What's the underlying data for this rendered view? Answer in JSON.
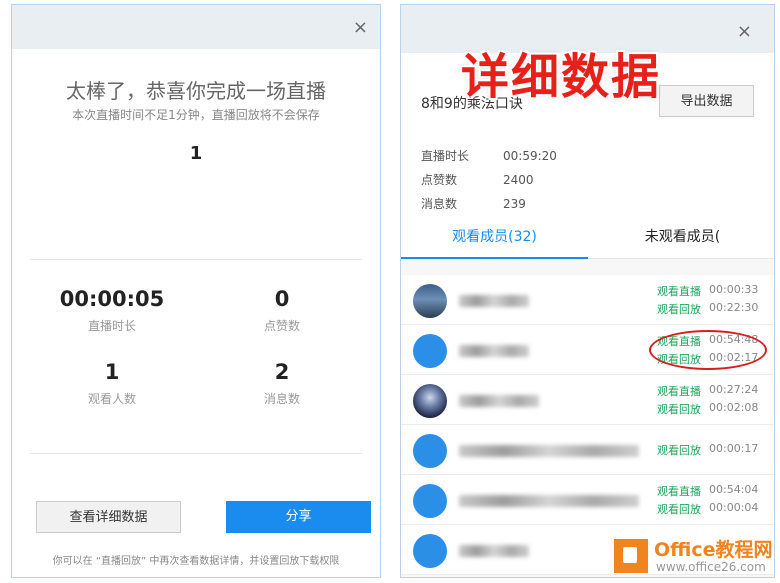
{
  "left_panel": {
    "close": "×",
    "title": "太棒了，恭喜你完成一场直播",
    "subtitle": "本次直播时间不足1分钟，直播回放将不会保存",
    "rank": "1",
    "stats": [
      {
        "value": "00:00:05",
        "label": "直播时长"
      },
      {
        "value": "0",
        "label": "点赞数"
      },
      {
        "value": "1",
        "label": "观看人数"
      },
      {
        "value": "2",
        "label": "消息数"
      }
    ],
    "buttons": {
      "details": "查看详细数据",
      "share": "分享"
    },
    "footer": "你可以在 “直播回放” 中再次查看数据详情，并设置回放下载权限"
  },
  "right_panel": {
    "close": "×",
    "overlay_title": "详细数据",
    "course": "8和9的乘法口诀",
    "export_button": "导出数据",
    "info": [
      {
        "label": "直播时长",
        "value": "00:59:20"
      },
      {
        "label": "点赞数",
        "value": "2400"
      },
      {
        "label": "消息数",
        "value": "239"
      }
    ],
    "tabs": {
      "watched": "观看成员(32)",
      "unwatched": "未观看成员("
    },
    "members": [
      {
        "avatar": "photo",
        "name_width": 70,
        "acts": [
          {
            "label": "观看直播",
            "time": "00:00:33"
          },
          {
            "label": "观看回放",
            "time": "00:22:30"
          }
        ]
      },
      {
        "avatar": "blue",
        "name_width": 70,
        "acts": [
          {
            "label": "观看直播",
            "time": "00:54:48"
          },
          {
            "label": "观看回放",
            "time": "00:02:17"
          }
        ]
      },
      {
        "avatar": "dark",
        "name_width": 80,
        "acts": [
          {
            "label": "观看直播",
            "time": "00:27:24"
          },
          {
            "label": "观看回放",
            "time": "00:02:08"
          }
        ]
      },
      {
        "avatar": "blue",
        "name_width": 180,
        "acts": [
          {
            "label": "观看回放",
            "time": "00:00:17"
          }
        ]
      },
      {
        "avatar": "blue",
        "name_width": 180,
        "acts": [
          {
            "label": "观看直播",
            "time": "00:54:04"
          },
          {
            "label": "观看回放",
            "time": "00:00:04"
          }
        ]
      },
      {
        "avatar": "blue",
        "name_width": 70,
        "acts": []
      }
    ]
  },
  "watermark": {
    "brand": "Office教程网",
    "url": "www.office26.com"
  },
  "colors": {
    "accent": "#1a8cf0",
    "green": "#21a55b",
    "red": "#d81e1e",
    "orange": "#f08420"
  }
}
